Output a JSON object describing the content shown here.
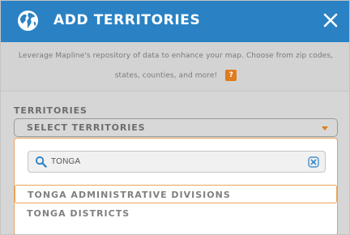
{
  "header": {
    "title": "ADD TERRITORIES",
    "icon": "globe-icon",
    "close_icon": "close-icon",
    "bg_color": "#2a82c4"
  },
  "description": {
    "line1": "Leverage Mapline's repository of data to enhance your map. Choose from zip codes,",
    "line2": "states, counties, and more!",
    "help_label": "?"
  },
  "territories": {
    "label": "TERRITORIES",
    "select_placeholder": "SELECT TERRITORIES"
  },
  "search": {
    "value": "TONGA",
    "icon": "search-icon",
    "clear_icon": "clear-icon"
  },
  "options": [
    {
      "label": "TONGA ADMINISTRATIVE DIVISIONS",
      "highlighted": true
    },
    {
      "label": "TONGA DISTRICTS",
      "highlighted": false
    }
  ],
  "colors": {
    "accent": "#e07b1e",
    "header": "#2a82c4",
    "overlay": "#d6d6d6"
  }
}
